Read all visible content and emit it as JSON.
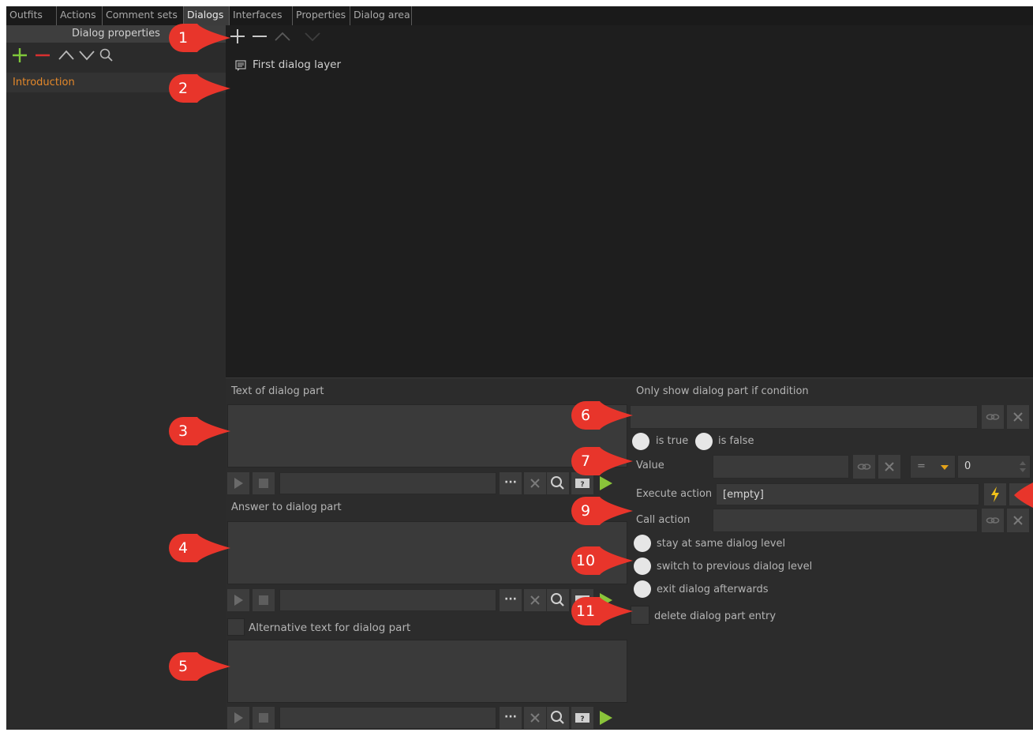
{
  "tabs": [
    "Outfits",
    "Actions",
    "Comment sets",
    "Dialogs",
    "Interfaces",
    "Properties",
    "Dialog area"
  ],
  "left_panel": {
    "header": "Dialog properties",
    "items": [
      "Introduction"
    ]
  },
  "tree": {
    "items": [
      "First dialog layer"
    ]
  },
  "text_section": {
    "label": "Text of dialog part",
    "dots": "···"
  },
  "answer_section": {
    "label": "Answer to dialog part",
    "dots": "···"
  },
  "alt_section": {
    "label": "Alternative text for dialog part",
    "dots": "···"
  },
  "condition": {
    "label": "Only show dialog part if condition",
    "is_true": "is true",
    "is_false": "is false",
    "value_label": "Value",
    "operator": "=",
    "value": "0",
    "execute_label": "Execute action",
    "execute_value": "[empty]",
    "call_label": "Call action",
    "stay": "stay at same dialog level",
    "switch_prev": "switch to previous dialog level",
    "exit": "exit dialog afterwards",
    "delete": "delete dialog part entry"
  },
  "markers": [
    "1",
    "2",
    "3",
    "4",
    "5",
    "6",
    "7",
    "9",
    "10",
    "11"
  ],
  "colors": {
    "accent_orange": "#e4882a",
    "add_green": "#7fc83a",
    "remove_red": "#d83030",
    "play_green": "#8ac43a",
    "lightning_yellow": "#f2c21a",
    "marker_red": "#e8352b"
  }
}
